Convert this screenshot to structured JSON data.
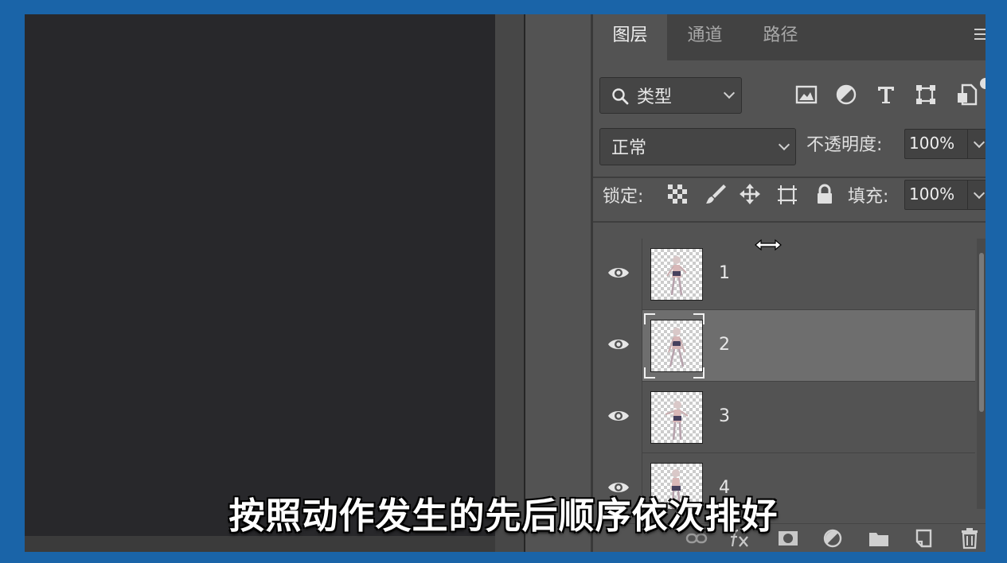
{
  "panel": {
    "tabs": [
      {
        "label": "图层",
        "active": true
      },
      {
        "label": "通道",
        "active": false
      },
      {
        "label": "路径",
        "active": false
      }
    ],
    "filter": {
      "label": "类型"
    },
    "filter_icons": [
      "image-filter-icon",
      "adjustment-filter-icon",
      "type-filter-icon",
      "shape-filter-icon",
      "smart-object-filter-icon"
    ],
    "blend_mode": "正常",
    "opacity": {
      "label": "不透明度:",
      "value": "100%"
    },
    "lock": {
      "label": "锁定:",
      "icons": [
        "lock-transparent-pixels-icon",
        "lock-image-pixels-icon",
        "lock-position-icon",
        "lock-artboard-icon",
        "lock-all-icon"
      ]
    },
    "fill": {
      "label": "填充:",
      "value": "100%"
    },
    "layers": [
      {
        "name": "1",
        "visible": true,
        "selected": false
      },
      {
        "name": "2",
        "visible": true,
        "selected": true
      },
      {
        "name": "3",
        "visible": true,
        "selected": false
      },
      {
        "name": "4",
        "visible": true,
        "selected": false
      }
    ],
    "bottom_icons": [
      "link-layers-icon",
      "fx-icon",
      "add-mask-icon",
      "adjustment-layer-icon",
      "new-group-icon",
      "new-layer-icon",
      "delete-layer-icon"
    ]
  },
  "subtitle": "按照动作发生的先后顺序依次排好",
  "colors": {
    "frame": "#1a64a8",
    "canvas": "#28282b",
    "panel": "#535353",
    "selected_row": "#6e6e6e"
  }
}
